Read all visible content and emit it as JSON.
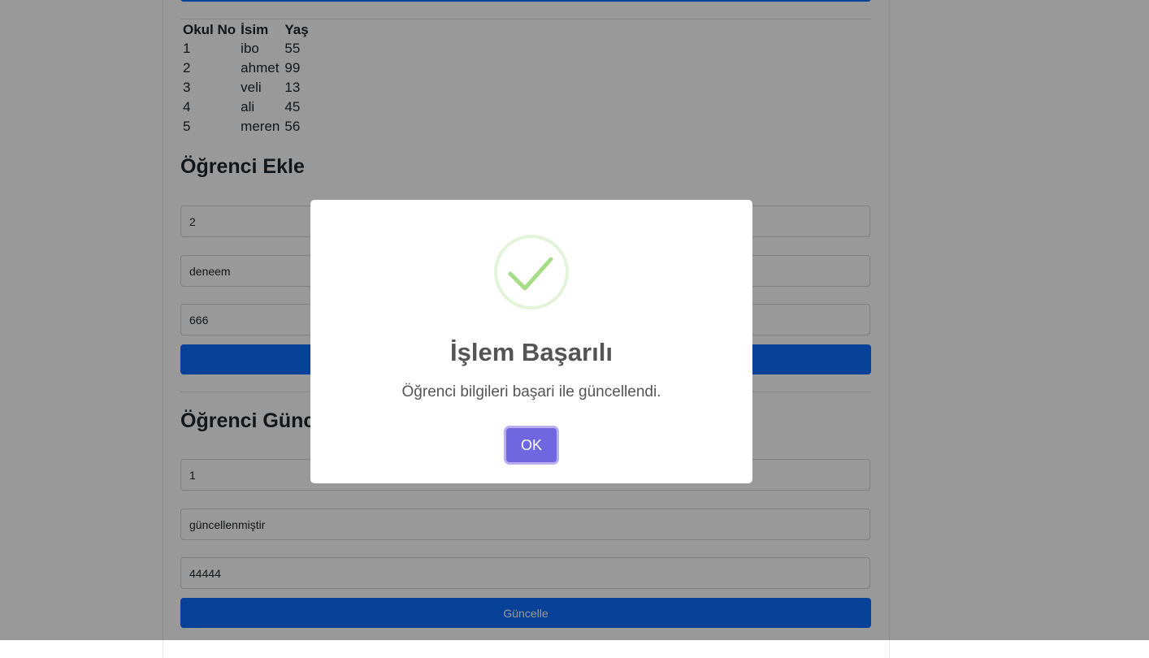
{
  "table": {
    "headers": [
      "Okul No",
      "İsim",
      "Yaş"
    ],
    "rows": [
      [
        "1",
        "ibo",
        "55"
      ],
      [
        "2",
        "ahmet",
        "99"
      ],
      [
        "3",
        "veli",
        "13"
      ],
      [
        "4",
        "ali",
        "45"
      ],
      [
        "5",
        "meren",
        "56"
      ]
    ]
  },
  "add_form": {
    "title": "Öğrenci Ekle",
    "no_value": "2",
    "name_value": "deneem",
    "age_value": "666",
    "button_label": ""
  },
  "update_form": {
    "title": "Öğrenci Güncelle",
    "no_value": "1",
    "name_value": "güncellenmiştir",
    "age_value": "44444",
    "button_label": "Güncelle"
  },
  "modal": {
    "icon": "success-check-icon",
    "title": "İşlem Başarılı",
    "text": "Öğrenci bilgileri başari ile güncellendi.",
    "ok_label": "OK"
  },
  "colors": {
    "primary": "#0d6efd",
    "modal_confirm": "#7066e0",
    "success": "#a5dc86"
  }
}
